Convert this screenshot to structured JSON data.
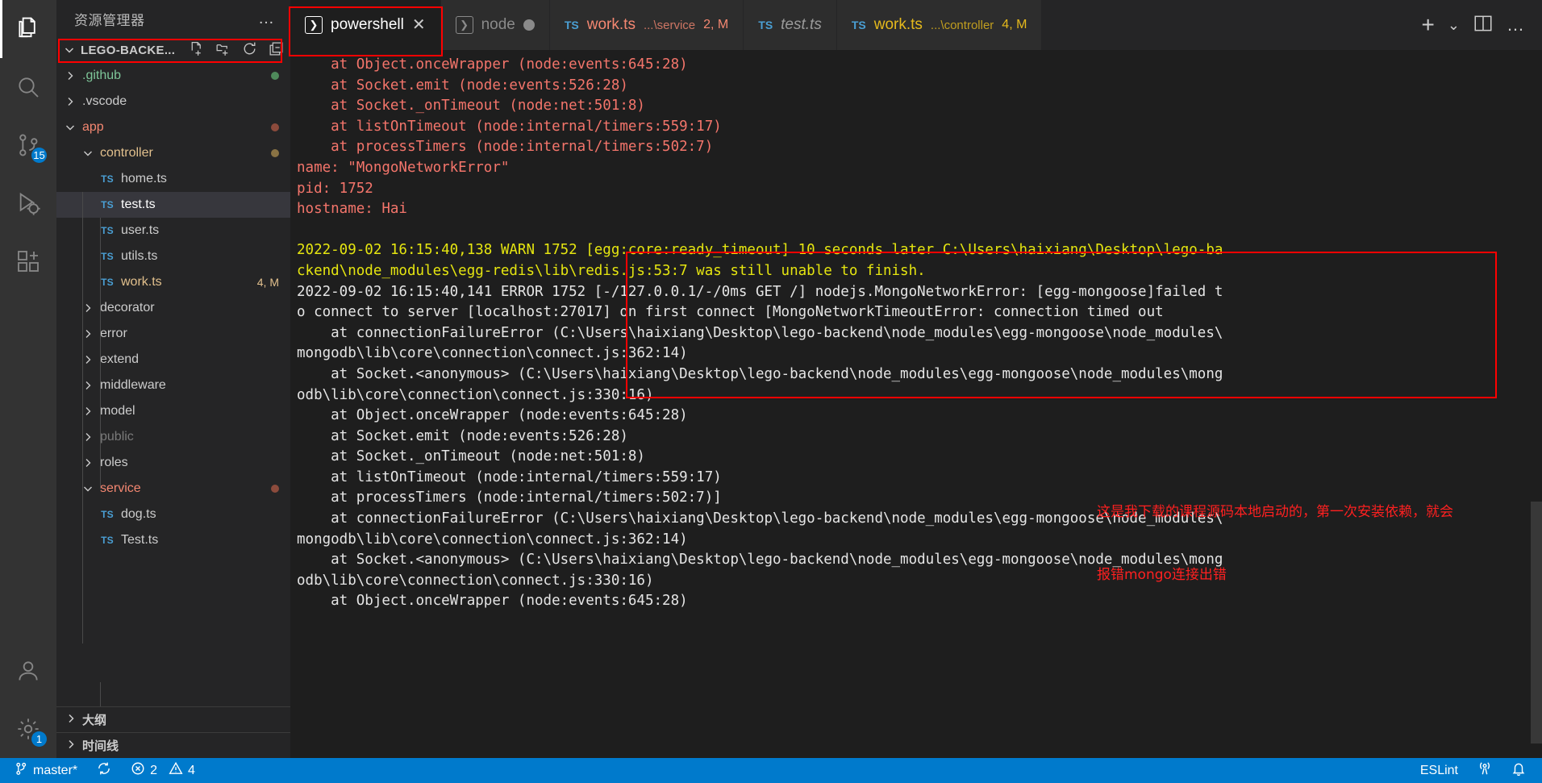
{
  "activity_bar": {
    "items": [
      {
        "name": "explorer",
        "icon": "files-icon",
        "active": true,
        "badge": null
      },
      {
        "name": "search",
        "icon": "search-icon",
        "active": false,
        "badge": null
      },
      {
        "name": "source-control",
        "icon": "source-control-icon",
        "active": false,
        "badge": "15"
      },
      {
        "name": "run-and-debug",
        "icon": "run-debug-icon",
        "active": false,
        "badge": null
      },
      {
        "name": "extensions",
        "icon": "extensions-icon",
        "active": false,
        "badge": null
      },
      {
        "name": "accounts",
        "icon": "account-icon",
        "active": false,
        "badge": null
      },
      {
        "name": "manage",
        "icon": "gear-icon",
        "active": false,
        "badge": "1"
      }
    ]
  },
  "sidebar": {
    "title": "资源管理器",
    "more_actions": "…",
    "folder": {
      "name": "LEGO-BACKE...",
      "expanded": true,
      "actions": [
        "new-file-icon",
        "new-folder-icon",
        "refresh-icon",
        "collapse-all-icon"
      ]
    },
    "tree": [
      {
        "label": ".github",
        "type": "folder",
        "expanded": false,
        "indent": 1,
        "color": "#7ec699",
        "dot": "#4f8a5b",
        "selected": false
      },
      {
        "label": ".vscode",
        "type": "folder",
        "expanded": false,
        "indent": 1,
        "color": "#cccccc",
        "dot": null,
        "selected": false
      },
      {
        "label": "app",
        "type": "folder",
        "expanded": true,
        "indent": 1,
        "color": "#f48771",
        "dot": "#8c4b3c",
        "selected": false
      },
      {
        "label": "controller",
        "type": "folder",
        "expanded": true,
        "indent": 2,
        "color": "#e2c08d",
        "dot": "#8a7344",
        "selected": false
      },
      {
        "label": "home.ts",
        "type": "file",
        "indent": 3,
        "color": "#cccccc",
        "meta": "",
        "selected": false
      },
      {
        "label": "test.ts",
        "type": "file",
        "indent": 3,
        "color": "#ffffff",
        "meta": "",
        "selected": true
      },
      {
        "label": "user.ts",
        "type": "file",
        "indent": 3,
        "color": "#cccccc",
        "meta": "",
        "selected": false
      },
      {
        "label": "utils.ts",
        "type": "file",
        "indent": 3,
        "color": "#cccccc",
        "meta": "",
        "selected": false
      },
      {
        "label": "work.ts",
        "type": "file",
        "indent": 3,
        "color": "#e2c08d",
        "meta": "4, M",
        "meta_color": "#e2c08d",
        "selected": false
      },
      {
        "label": "decorator",
        "type": "folder",
        "expanded": false,
        "indent": 2,
        "color": "#cccccc",
        "dot": null,
        "selected": false
      },
      {
        "label": "error",
        "type": "folder",
        "expanded": false,
        "indent": 2,
        "color": "#cccccc",
        "dot": null,
        "selected": false
      },
      {
        "label": "extend",
        "type": "folder",
        "expanded": false,
        "indent": 2,
        "color": "#cccccc",
        "dot": null,
        "selected": false
      },
      {
        "label": "middleware",
        "type": "folder",
        "expanded": false,
        "indent": 2,
        "color": "#cccccc",
        "dot": null,
        "selected": false
      },
      {
        "label": "model",
        "type": "folder",
        "expanded": false,
        "indent": 2,
        "color": "#cccccc",
        "dot": null,
        "selected": false
      },
      {
        "label": "public",
        "type": "folder",
        "expanded": false,
        "indent": 2,
        "color": "#7a7a7a",
        "dot": null,
        "selected": false
      },
      {
        "label": "roles",
        "type": "folder",
        "expanded": false,
        "indent": 2,
        "color": "#cccccc",
        "dot": null,
        "selected": false
      },
      {
        "label": "service",
        "type": "folder",
        "expanded": true,
        "indent": 2,
        "color": "#f48771",
        "dot": "#8c4b3c",
        "selected": false
      },
      {
        "label": "dog.ts",
        "type": "file",
        "indent": 3,
        "color": "#cccccc",
        "meta": "",
        "selected": false
      },
      {
        "label": "Test.ts",
        "type": "file",
        "indent": 3,
        "color": "#cccccc",
        "meta": "",
        "selected": false
      }
    ],
    "panels": [
      {
        "label": "大纲",
        "expanded": false
      },
      {
        "label": "时间线",
        "expanded": false
      }
    ]
  },
  "tabs": [
    {
      "kind": "terminal",
      "name": "powershell",
      "path": "",
      "meta": "",
      "active": true,
      "close": "✕",
      "dirty": false,
      "italic": false,
      "name_color": "#ffffff",
      "highlighted": true
    },
    {
      "kind": "terminal",
      "name": "node",
      "path": "",
      "meta": "",
      "active": false,
      "close": "",
      "dirty": true,
      "italic": false,
      "name_color": "#8a8a8a",
      "highlighted": false
    },
    {
      "kind": "file",
      "name": "work.ts",
      "path": "...\\service",
      "meta": "2, M",
      "active": false,
      "close": "",
      "dirty": false,
      "italic": false,
      "name_color": "#f48771",
      "highlighted": false
    },
    {
      "kind": "file",
      "name": "test.ts",
      "path": "",
      "meta": "",
      "active": false,
      "close": "",
      "dirty": false,
      "italic": true,
      "name_color": "#9a9a9a",
      "highlighted": false
    },
    {
      "kind": "file",
      "name": "work.ts",
      "path": "...\\controller",
      "meta": "4, M",
      "active": false,
      "close": "",
      "dirty": false,
      "italic": false,
      "name_color": "#e5b91c",
      "highlighted": false
    }
  ],
  "tab_actions": {
    "new": "+",
    "chevron": "⌄",
    "split": "split-editor-icon",
    "more": "…"
  },
  "terminal": {
    "lines": [
      {
        "text": "    at Object.onceWrapper (node:events:645:28)",
        "color": "red"
      },
      {
        "text": "    at Socket.emit (node:events:526:28)",
        "color": "red"
      },
      {
        "text": "    at Socket._onTimeout (node:net:501:8)",
        "color": "red"
      },
      {
        "text": "    at listOnTimeout (node:internal/timers:559:17)",
        "color": "red"
      },
      {
        "text": "    at processTimers (node:internal/timers:502:7)",
        "color": "red"
      },
      {
        "text": "name: \"MongoNetworkError\"",
        "color": "red"
      },
      {
        "text": "pid: 1752",
        "color": "red"
      },
      {
        "text": "hostname: Hai",
        "color": "red"
      },
      {
        "text": "",
        "color": "red"
      },
      {
        "text": "2022-09-02 16:15:40,138 WARN 1752 [egg:core:ready_timeout] 10 seconds later C:\\Users\\haixiang\\Desktop\\lego-ba",
        "color": "yellow"
      },
      {
        "text": "ckend\\node_modules\\egg-redis\\lib\\redis.js:53:7 was still unable to finish.",
        "color": "yellow"
      },
      {
        "text": "2022-09-02 16:15:40,141 ERROR 1752 [-/127.0.0.1/-/0ms GET /] nodejs.MongoNetworkError: [egg-mongoose]failed t",
        "color": "white"
      },
      {
        "text": "o connect to server [localhost:27017] on first connect [MongoNetworkTimeoutError: connection timed out",
        "color": "white"
      },
      {
        "text": "    at connectionFailureError (C:\\Users\\haixiang\\Desktop\\lego-backend\\node_modules\\egg-mongoose\\node_modules\\",
        "color": "white"
      },
      {
        "text": "mongodb\\lib\\core\\connection\\connect.js:362:14)",
        "color": "white"
      },
      {
        "text": "    at Socket.<anonymous> (C:\\Users\\haixiang\\Desktop\\lego-backend\\node_modules\\egg-mongoose\\node_modules\\mong",
        "color": "white"
      },
      {
        "text": "odb\\lib\\core\\connection\\connect.js:330:16)",
        "color": "white"
      },
      {
        "text": "    at Object.onceWrapper (node:events:645:28)",
        "color": "white"
      },
      {
        "text": "    at Socket.emit (node:events:526:28)",
        "color": "white"
      },
      {
        "text": "    at Socket._onTimeout (node:net:501:8)",
        "color": "white"
      },
      {
        "text": "    at listOnTimeout (node:internal/timers:559:17)",
        "color": "white"
      },
      {
        "text": "    at processTimers (node:internal/timers:502:7)]",
        "color": "white"
      },
      {
        "text": "    at connectionFailureError (C:\\Users\\haixiang\\Desktop\\lego-backend\\node_modules\\egg-mongoose\\node_modules\\",
        "color": "white"
      },
      {
        "text": "mongodb\\lib\\core\\connection\\connect.js:362:14)",
        "color": "white"
      },
      {
        "text": "    at Socket.<anonymous> (C:\\Users\\haixiang\\Desktop\\lego-backend\\node_modules\\egg-mongoose\\node_modules\\mong",
        "color": "white"
      },
      {
        "text": "odb\\lib\\core\\connection\\connect.js:330:16)",
        "color": "white"
      },
      {
        "text": "    at Object.onceWrapper (node:events:645:28)",
        "color": "white"
      }
    ]
  },
  "annotation": {
    "line1": "这是我下载的课程源码本地启动的，第一次安装依赖，就会",
    "line2": "报错mongo连接出错",
    "color": "#ff2020"
  },
  "status_bar": {
    "remote_icon": "remote-indicator-icon",
    "branch": "master*",
    "sync_icon": "sync-icon",
    "errors": "2",
    "warnings": "4",
    "eslint": "ESLint",
    "broadcast_icon": "radio-tower-icon",
    "bell_icon": "bell-icon"
  },
  "colors": {
    "accent": "#007acc",
    "terminal_red": "#f4756b",
    "terminal_yellow": "#e5e510",
    "terminal_white": "#e5e5e5",
    "annotation_red": "#ff0000",
    "background": "#1e1e1e",
    "sidebar_background": "#252526",
    "activity_background": "#333333"
  }
}
